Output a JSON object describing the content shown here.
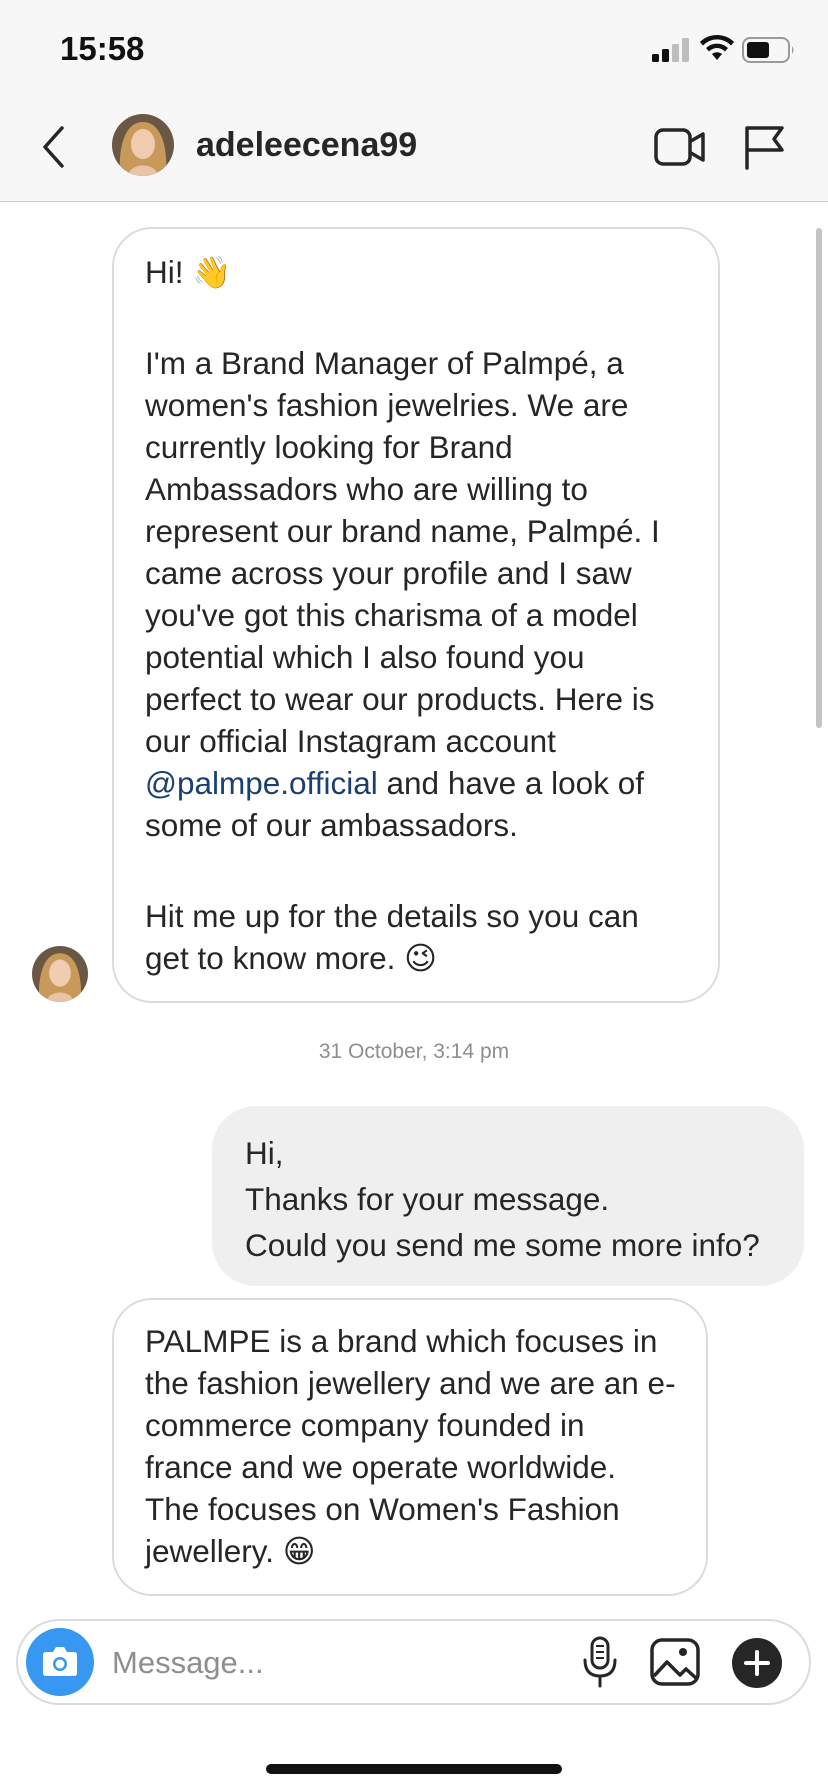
{
  "status_bar": {
    "time": "15:58"
  },
  "header": {
    "username": "adeleecena99"
  },
  "messages": [
    {
      "sender": "them",
      "paragraphs": [
        "Hi! 👋",
        "I'm a Brand Manager of Palmpé, a women's fashion jewelries. We are currently looking for Brand Ambassadors who are willing to represent our brand name, Palmpé.  I came across your profile and I saw you've got this charisma of a model potential which I also found you perfect to wear our products. Here is our official Instagram account",
        "@palmpe.official",
        " and have a look of some of our ambassadors.",
        "Hit me up for the details so you can get to know more. 😉"
      ]
    },
    {
      "timestamp": "31 October, 3:14 pm"
    },
    {
      "sender": "me",
      "lines": [
        "Hi,",
        "Thanks for your message.",
        "Could you send me some more info?"
      ]
    },
    {
      "sender": "them",
      "text": "PALMPE is a brand which focuses in the fashion jewellery and we are an e-commerce company founded in france and we operate worldwide. The focuses on Women's Fashion jewellery. 😁"
    }
  ],
  "composer": {
    "placeholder": "Message..."
  },
  "icons": {
    "back": "chevron-left-icon",
    "video": "video-camera-icon",
    "flag": "flag-icon",
    "camera": "camera-icon",
    "mic": "microphone-icon",
    "gallery": "image-icon",
    "plus": "plus-icon"
  },
  "colors": {
    "accent": "#3897f0",
    "mention": "#1c3f73",
    "sent_bubble": "#efefef"
  }
}
